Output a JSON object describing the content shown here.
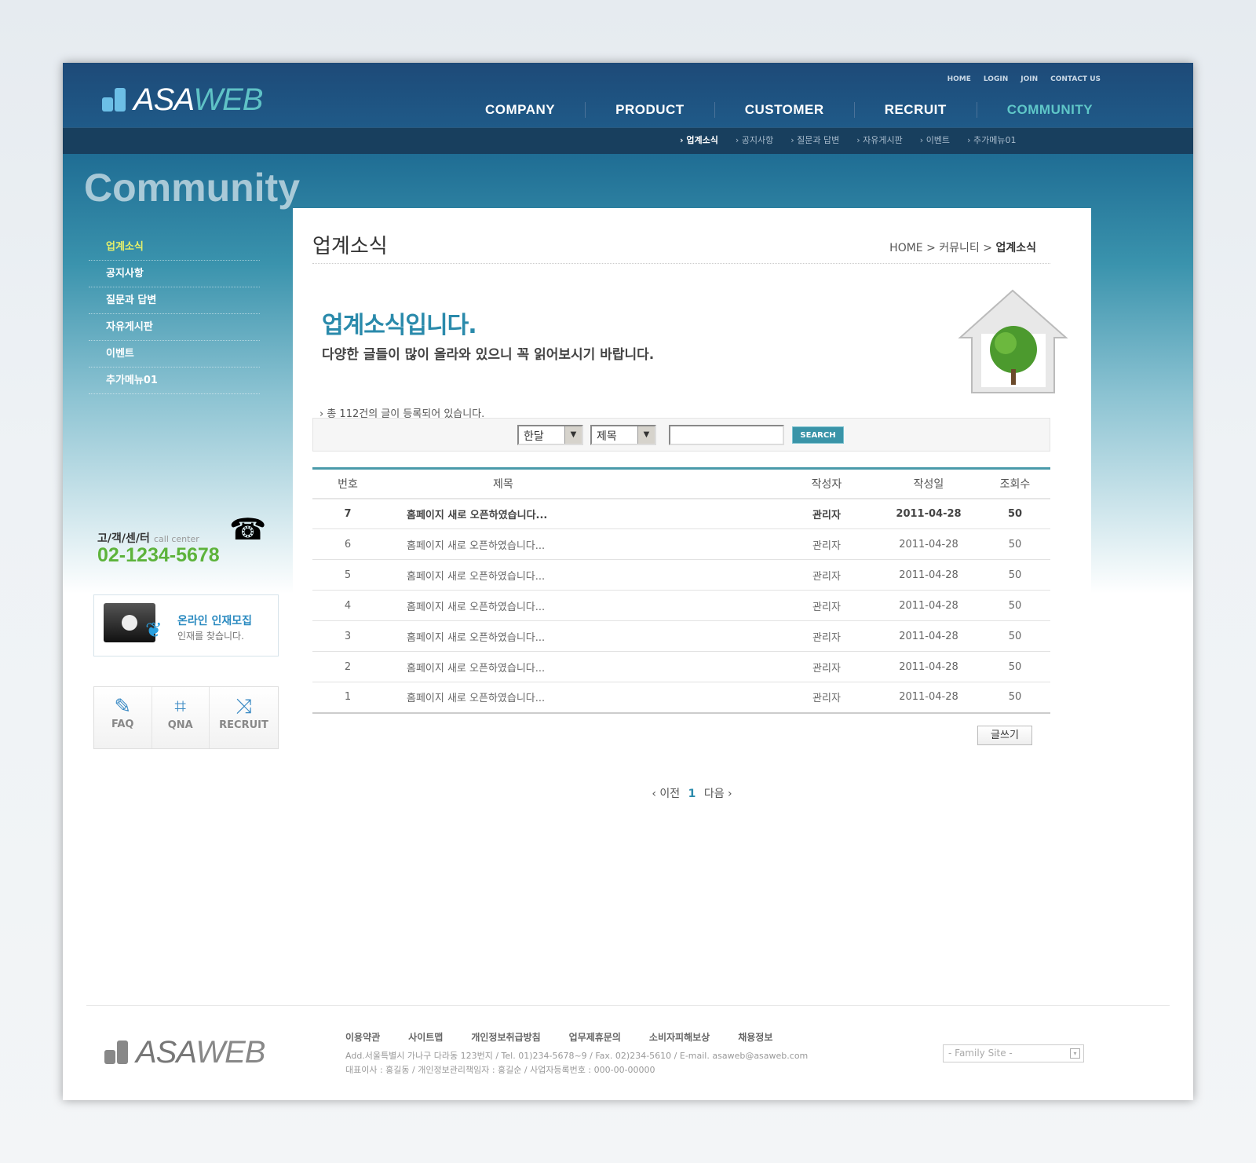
{
  "logo": {
    "a": "ASA",
    "b": "WEB"
  },
  "top_links": [
    "HOME",
    "LOGIN",
    "JOIN",
    "CONTACT US"
  ],
  "nav": [
    "COMPANY",
    "PRODUCT",
    "CUSTOMER",
    "RECRUIT",
    "COMMUNITY"
  ],
  "subnav": [
    "업계소식",
    "공지사항",
    "질문과 답변",
    "자유게시판",
    "이벤트",
    "추가메뉴01"
  ],
  "section_title": "Community",
  "sidebar": {
    "items": [
      "업계소식",
      "공지사항",
      "질문과 답변",
      "자유게시판",
      "이벤트",
      "추가메뉴01"
    ],
    "call_label": "고/객/센/터",
    "call_sub": "call center",
    "phone": "02-1234-5678",
    "recruit_title": "온라인 인재모집",
    "recruit_sub": "인재를 찾습니다.",
    "quick": [
      "FAQ",
      "QNA",
      "RECRUIT"
    ]
  },
  "page": {
    "title": "업계소식",
    "breadcrumb": [
      "HOME",
      "커뮤니티",
      "업계소식"
    ],
    "intro_title": "업계소식입니다.",
    "intro_sub": "다양한 글들이 많이 올라와 있으니 꼭 읽어보시기 바랍니다.",
    "count_text": "총 112건의 글이 등록되어 있습니다."
  },
  "search": {
    "period": "한달",
    "field": "제목",
    "query": "",
    "button": "SEARCH"
  },
  "table": {
    "headers": [
      "번호",
      "제목",
      "작성자",
      "작성일",
      "조회수"
    ],
    "rows": [
      [
        "7",
        "홈페이지 새로 오픈하였습니다...",
        "관리자",
        "2011-04-28",
        "50"
      ],
      [
        "6",
        "홈페이지 새로 오픈하였습니다...",
        "관리자",
        "2011-04-28",
        "50"
      ],
      [
        "5",
        "홈페이지 새로 오픈하였습니다...",
        "관리자",
        "2011-04-28",
        "50"
      ],
      [
        "4",
        "홈페이지 새로 오픈하였습니다...",
        "관리자",
        "2011-04-28",
        "50"
      ],
      [
        "3",
        "홈페이지 새로 오픈하였습니다...",
        "관리자",
        "2011-04-28",
        "50"
      ],
      [
        "2",
        "홈페이지 새로 오픈하였습니다...",
        "관리자",
        "2011-04-28",
        "50"
      ],
      [
        "1",
        "홈페이지 새로 오픈하였습니다...",
        "관리자",
        "2011-04-28",
        "50"
      ]
    ]
  },
  "write_button": "글쓰기",
  "pagination": {
    "prev": "이전",
    "current": "1",
    "next": "다음"
  },
  "footer": {
    "links": [
      "이용약관",
      "사이트맵",
      "개인정보취급방침",
      "업무제휴문의",
      "소비자피해보상",
      "채용정보"
    ],
    "address": "Add.서울특별시 가나구 다라동 123번지 / Tel. 01)234-5678~9 / Fax. 02)234-5610 / E-mail. asaweb@asaweb.com",
    "company": "대표이사 : 홍길동 / 개인정보관리책임자 : 홍길순 / 사업자등록번호 : 000-00-00000",
    "family_site": "- Family Site -"
  },
  "colors": {
    "header": "#1e4a78",
    "accent": "#2a8aab",
    "active_nav": "#5fc7c8",
    "phone": "#5db33b"
  }
}
